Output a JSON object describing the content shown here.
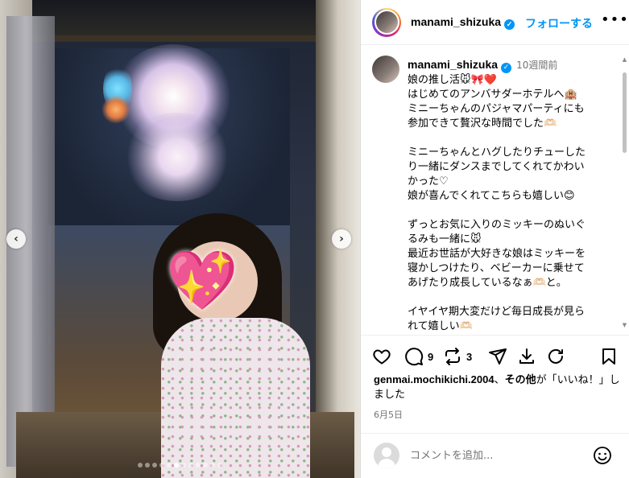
{
  "post": {
    "username": "manami_shizuka",
    "follow_label": "フォローする",
    "more_label": "•••",
    "verified_mark": "✓"
  },
  "carousel": {
    "prev_label": "‹",
    "next_label": "›",
    "slide_count": 12,
    "current_index": 5,
    "sticker_emoji": "💖"
  },
  "caption": {
    "username": "manami_shizuka",
    "time": "10週間前",
    "lines": [
      "娘の推し活🐭🎀❤️",
      "はじめてのアンバサダーホテルへ🏨",
      "ミニーちゃんのパジャマパーティにも",
      "参加できて贅沢な時間でした🫶🏻",
      "",
      "ミニーちゃんとハグしたりチューした",
      "り一緒にダンスまでしてくれてかわい",
      "かった♡",
      "娘が喜んでくれてこちらも嬉しい😊",
      "",
      "ずっとお気に入りのミッキーのぬいぐ",
      "るみも一緒に🐭",
      "最近お世話が大好きな娘はミッキーを",
      "寝かしつけたり、ベビーカーに乗せて",
      "あげたり成長しているなぁ🫶🏻と。",
      "",
      "イヤイヤ期大変だけど毎日成長が見ら",
      "れて嬉しい🫶🏻"
    ]
  },
  "actions": {
    "like_icon": "heart-icon",
    "comment_count": "9",
    "repost_count": "3",
    "share_icon": "paper-plane-icon",
    "save_icon": "bookmark-icon"
  },
  "likes": {
    "user": "genmai.mochikichi.2004",
    "separator": "、",
    "others": "その他",
    "rest": "が「いいね！」しました"
  },
  "date": "6月5日",
  "comment": {
    "placeholder": "コメントを追加..."
  }
}
